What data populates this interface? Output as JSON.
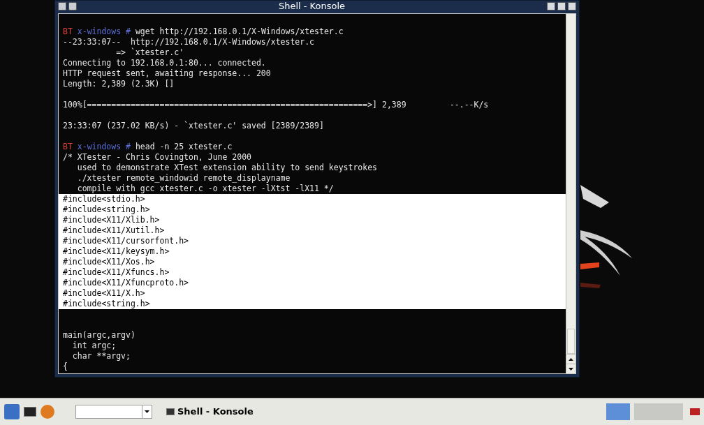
{
  "window": {
    "title": "Shell - Konsole"
  },
  "terminal": {
    "lines": [
      {
        "kind": "prompt",
        "host": "BT",
        "dir": "x-windows",
        "symbol": "#",
        "command": "wget http://192.168.0.1/X-Windows/xtester.c",
        "selected": false
      },
      {
        "kind": "output",
        "text": "--23:33:07--  http://192.168.0.1/X-Windows/xtester.c",
        "selected": false
      },
      {
        "kind": "output",
        "text": "           => `xtester.c'",
        "selected": false
      },
      {
        "kind": "output",
        "text": "Connecting to 192.168.0.1:80... connected.",
        "selected": false
      },
      {
        "kind": "output",
        "text": "HTTP request sent, awaiting response... 200",
        "selected": false
      },
      {
        "kind": "output",
        "text": "Length: 2,389 (2.3K) []",
        "selected": false
      },
      {
        "kind": "blank",
        "selected": false
      },
      {
        "kind": "output",
        "text": "100%[==========================================================>] 2,389         --.--K/s",
        "selected": false
      },
      {
        "kind": "blank",
        "selected": false
      },
      {
        "kind": "output",
        "text": "23:33:07 (237.02 KB/s) - `xtester.c' saved [2389/2389]",
        "selected": false
      },
      {
        "kind": "blank",
        "selected": false
      },
      {
        "kind": "prompt",
        "host": "BT",
        "dir": "x-windows",
        "symbol": "#",
        "command": "head -n 25 xtester.c",
        "selected": false
      },
      {
        "kind": "output",
        "text": "/* XTester - Chris Covington, June 2000",
        "selected": false
      },
      {
        "kind": "output",
        "text": "   used to demonstrate XTest extension ability to send keystrokes",
        "selected": false
      },
      {
        "kind": "output",
        "text": "   ./xtester remote_windowid remote_displayname",
        "selected": false
      },
      {
        "kind": "output",
        "text": "   compile with gcc xtester.c -o xtester -lXtst -lX11 */",
        "selected": false
      },
      {
        "kind": "output",
        "text": "#include<stdio.h>",
        "selected": true
      },
      {
        "kind": "output",
        "text": "#include<string.h>",
        "selected": true
      },
      {
        "kind": "output",
        "text": "#include<X11/Xlib.h>",
        "selected": true
      },
      {
        "kind": "output",
        "text": "#include<X11/Xutil.h>",
        "selected": true
      },
      {
        "kind": "output",
        "text": "#include<X11/cursorfont.h>",
        "selected": true
      },
      {
        "kind": "output",
        "text": "#include<X11/keysym.h>",
        "selected": true
      },
      {
        "kind": "output",
        "text": "#include<X11/Xos.h>",
        "selected": true
      },
      {
        "kind": "output",
        "text": "#include<X11/Xfuncs.h>",
        "selected": true
      },
      {
        "kind": "output",
        "text": "#include<X11/Xfuncproto.h>",
        "selected": true
      },
      {
        "kind": "output",
        "text": "#include<X11/X.h>",
        "selected": true
      },
      {
        "kind": "output",
        "text": "#include<string.h>",
        "selected": true
      },
      {
        "kind": "blank",
        "selected": false
      },
      {
        "kind": "blank",
        "selected": false
      },
      {
        "kind": "output",
        "text": "main(argc,argv)",
        "selected": false
      },
      {
        "kind": "output",
        "text": "  int argc;",
        "selected": false
      },
      {
        "kind": "output",
        "text": "  char **argv;",
        "selected": false
      },
      {
        "kind": "output",
        "text": "{",
        "selected": false
      }
    ]
  },
  "taskbar": {
    "tasks": [
      {
        "label": "Shell - Konsole",
        "selected": true
      }
    ]
  }
}
